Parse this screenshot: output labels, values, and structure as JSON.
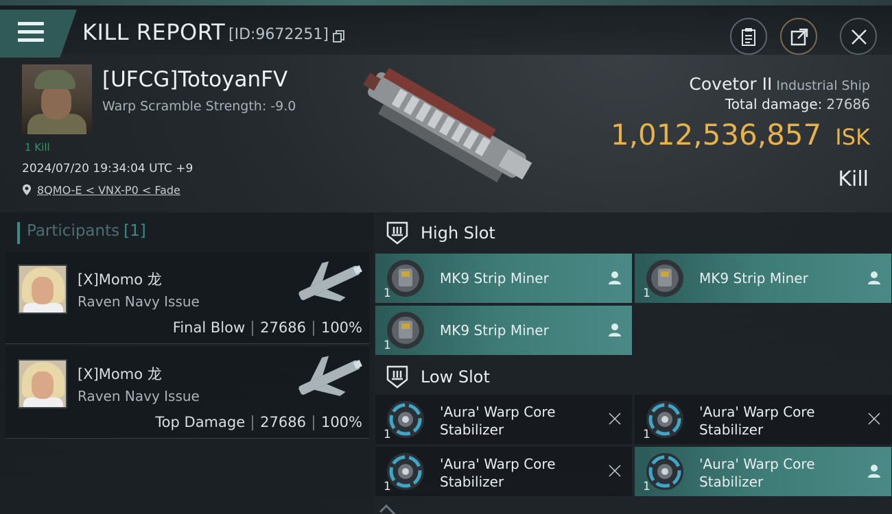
{
  "header": {
    "title": "KILL REPORT",
    "report_id": "[ID:9672251]"
  },
  "victim": {
    "name": "[UFCG]TotoyanFV",
    "warp_scramble": "Warp Scramble Strength: -9.0",
    "kills": "1 Kill",
    "timestamp": "2024/07/20 19:34:04 UTC +9",
    "location": "8QMO-E < VNX-P0 < Fade",
    "ship_name": "Covetor II",
    "ship_class": "Industrial Ship",
    "total_damage_label": "Total damage:",
    "total_damage": "27686",
    "isk_value": "1,012,536,857",
    "isk_unit": "ISK",
    "result": "Kill"
  },
  "participants": {
    "title": "Participants",
    "count": "[1]",
    "rows": [
      {
        "name": "[X]Momo 龙",
        "ship": "Raven Navy Issue",
        "role": "Final Blow",
        "damage": "27686",
        "percent": "100%"
      },
      {
        "name": "[X]Momo 龙",
        "ship": "Raven Navy Issue",
        "role": "Top Damage",
        "damage": "27686",
        "percent": "100%"
      }
    ]
  },
  "fitting": {
    "high_slot_label": "High Slot",
    "low_slot_label": "Low Slot",
    "high": [
      {
        "name": "MK9 Strip Miner",
        "qty": "1",
        "status": "dropped"
      },
      {
        "name": "MK9 Strip Miner",
        "qty": "1",
        "status": "dropped"
      },
      {
        "name": "MK9 Strip Miner",
        "qty": "1",
        "status": "dropped"
      }
    ],
    "low": [
      {
        "name": "'Aura' Warp Core Stabilizer",
        "qty": "1",
        "status": "destroyed"
      },
      {
        "name": "'Aura' Warp Core Stabilizer",
        "qty": "1",
        "status": "destroyed"
      },
      {
        "name": "'Aura' Warp Core Stabilizer",
        "qty": "1",
        "status": "destroyed"
      },
      {
        "name": "'Aura' Warp Core Stabilizer",
        "qty": "1",
        "status": "dropped"
      }
    ]
  },
  "colors": {
    "accent_teal": "#3f7c78",
    "isk_gold": "#e8b24a",
    "kill_green": "#3e8f6a"
  },
  "icons": {
    "menu": "menu-icon",
    "copy": "copy-icon",
    "clipboard": "clipboard-icon",
    "share": "share-icon",
    "close": "close-icon",
    "location": "location-pin-icon",
    "slot": "slot-shield-icon",
    "pilot": "person-icon",
    "destroyed": "x-icon"
  }
}
